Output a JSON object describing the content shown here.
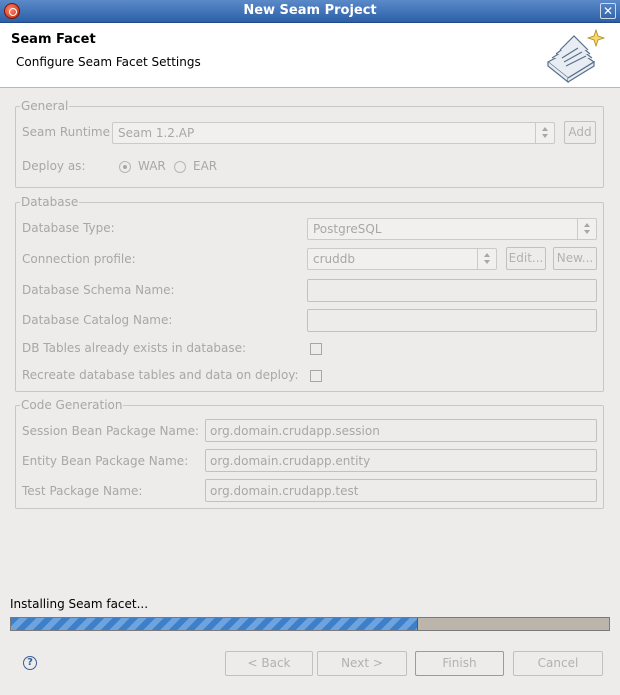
{
  "window": {
    "title": "New Seam Project"
  },
  "header": {
    "title": "Seam Facet",
    "subtitle": "Configure Seam Facet Settings"
  },
  "general": {
    "legend": "General",
    "runtime_label": "Seam Runtime",
    "runtime_value": "Seam 1.2.AP",
    "add_label": "Add",
    "deploy_label": "Deploy as:",
    "war_label": "WAR",
    "ear_label": "EAR",
    "deploy_selected": "WAR"
  },
  "database": {
    "legend": "Database",
    "type_label": "Database Type:",
    "type_value": "PostgreSQL",
    "profile_label": "Connection profile:",
    "profile_value": "cruddb",
    "edit_label": "Edit...",
    "new_label": "New...",
    "schema_label": "Database Schema Name:",
    "schema_value": "",
    "catalog_label": "Database Catalog Name:",
    "catalog_value": "",
    "tables_exist_label": "DB Tables already exists in database:",
    "tables_exist_checked": false,
    "recreate_label": "Recreate database tables and data on deploy:",
    "recreate_checked": false
  },
  "codegen": {
    "legend": "Code Generation",
    "session_label": "Session Bean Package Name:",
    "session_value": "org.domain.crudapp.session",
    "entity_label": "Entity Bean Package Name:",
    "entity_value": "org.domain.crudapp.entity",
    "test_label": "Test Package Name:",
    "test_value": "org.domain.crudapp.test"
  },
  "status": {
    "text": "Installing Seam facet...",
    "progress": 0.68
  },
  "footer": {
    "back_label": "< Back",
    "next_label": "Next >",
    "finish_label": "Finish",
    "cancel_label": "Cancel"
  },
  "icons": {
    "app": "app-icon",
    "close": "close-icon",
    "banner": "wizard-banner-icon",
    "help": "help-icon"
  }
}
